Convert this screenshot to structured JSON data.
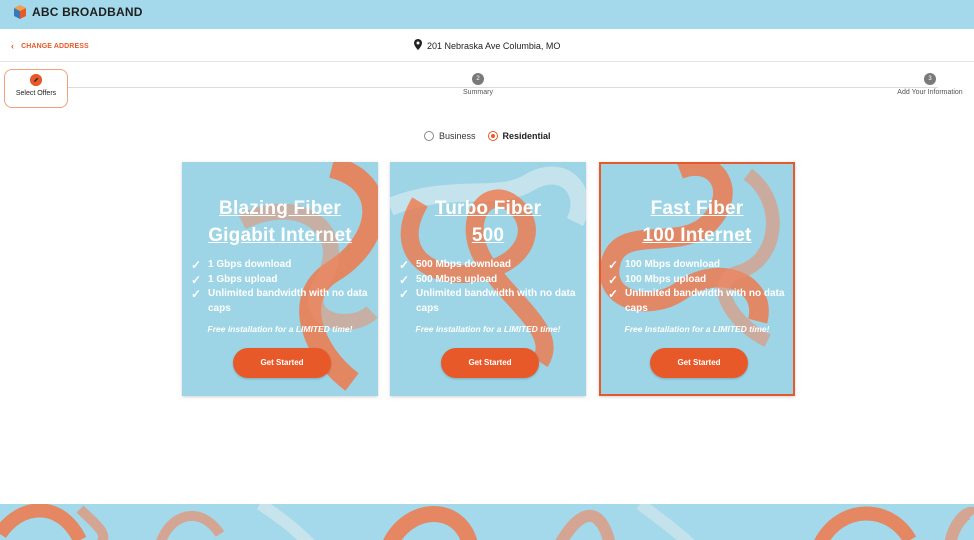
{
  "brand": {
    "name": "ABC BROADBAND",
    "icon": "cube-logo-icon"
  },
  "address_bar": {
    "change_label": "CHANGE ADDRESS",
    "address": "201 Nebraska Ave Columbia, MO",
    "icon": "map-pin-icon"
  },
  "stepper": {
    "steps": [
      {
        "label": "Select Offers",
        "number": "",
        "icon": "pencil-icon",
        "active": true
      },
      {
        "label": "Summary",
        "number": "2",
        "active": false
      },
      {
        "label": "Add Your Information",
        "number": "3",
        "active": false
      }
    ]
  },
  "customer_type": {
    "options": [
      {
        "label": "Business",
        "selected": false
      },
      {
        "label": "Residential",
        "selected": true
      }
    ]
  },
  "offers": [
    {
      "title_line1": "Blazing Fiber",
      "title_line2": "Gigabit Internet",
      "features": [
        "1 Gbps download",
        "1 Gbps upload",
        "Unlimited bandwidth with no data caps"
      ],
      "promo": "Free Installation for a LIMITED time!",
      "cta": "Get Started",
      "selected": false
    },
    {
      "title_line1": "Turbo Fiber",
      "title_line2": "500",
      "features": [
        "500 Mbps download",
        "500 Mbps upload",
        "Unlimited bandwidth with no data caps"
      ],
      "promo": "Free Installation for a LIMITED time!",
      "cta": "Get Started",
      "selected": false
    },
    {
      "title_line1": "Fast Fiber",
      "title_line2": "100 Internet",
      "features": [
        "100 Mbps download",
        "100 Mbps upload",
        "Unlimited bandwidth with no data caps"
      ],
      "promo": "Free Installation for a LIMITED time!",
      "cta": "Get Started",
      "selected": true
    }
  ],
  "colors": {
    "accent": "#e8592a",
    "sky": "#9dd4e6",
    "header": "#a3d9ea"
  }
}
